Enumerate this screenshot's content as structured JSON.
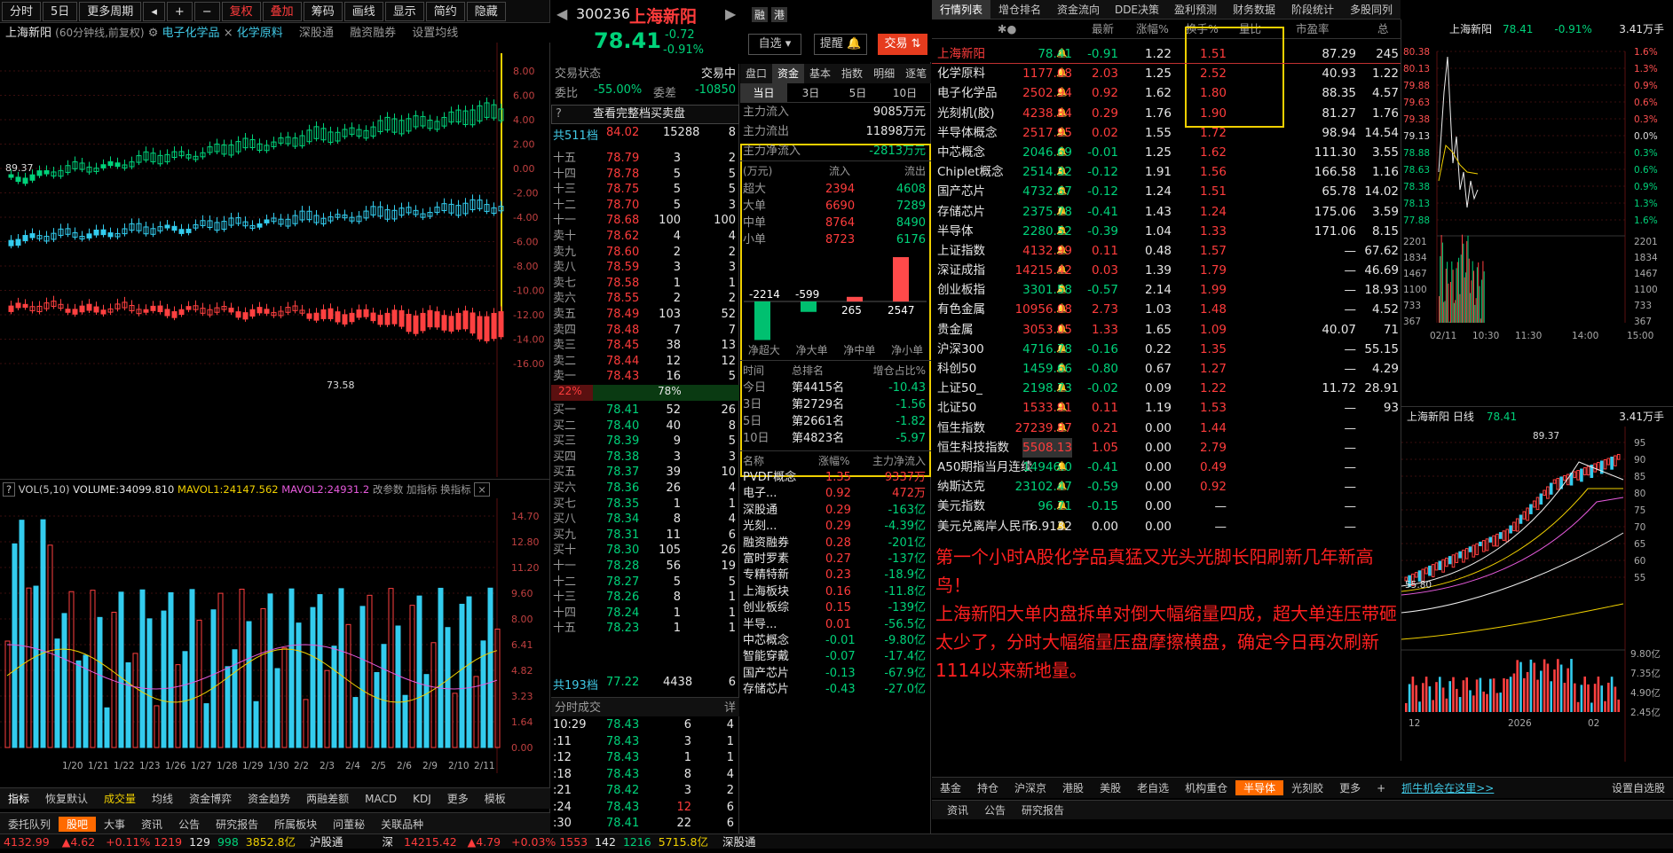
{
  "toolbar": {
    "items": [
      "分时",
      "5日",
      "更多周期",
      "复权",
      "叠加",
      "筹码",
      "画线",
      "显示",
      "简约",
      "隐藏"
    ]
  },
  "left": {
    "stock_title": "上海新阳",
    "title_meta": "(60分钟线,前复权)",
    "tags": [
      "电子化学品",
      "化学原料",
      "深股通",
      "融资融券",
      "设置均线"
    ],
    "price_axis": [
      "8.00",
      "6.00",
      "4.00",
      "2.00",
      "0.00",
      "-2.00",
      "-4.00",
      "-6.00",
      "-8.00",
      "-10.00",
      "-12.00",
      "-14.00",
      "-16.00"
    ],
    "marker_left": "89.37",
    "marker_low": "73.58",
    "vol_header": {
      "label": "VOL(5,10)",
      "volume": "VOLUME:34099.810",
      "mavol1": "MAVOL1:24147.562",
      "mavol2": "MAVOL2:24931.2",
      "params": "改参数",
      "add": "加指标",
      "swap": "换指标"
    },
    "vol_axis": [
      "14.70",
      "12.80",
      "11.20",
      "9.60",
      "8.00",
      "6.41",
      "4.82",
      "3.23",
      "1.64",
      "0.00"
    ],
    "dates": [
      "1/20",
      "1/21",
      "1/22",
      "1/23",
      "1/26",
      "1/27",
      "1/28",
      "1/29",
      "1/30",
      "2/2",
      "2/3",
      "2/4",
      "2/5",
      "2/6",
      "2/9",
      "2/10",
      "2/11"
    ],
    "ind_tabs": [
      "指标",
      "恢复默认",
      "成交量",
      "均线",
      "资金博弈",
      "资金趋势",
      "两融差额",
      "MACD",
      "KDJ",
      "更多",
      "模板"
    ],
    "bottom_tabs": [
      "委托队列",
      "股吧",
      "大事",
      "资讯",
      "公告",
      "研究报告",
      "所属板块",
      "问董秘",
      "关联品种"
    ]
  },
  "mid": {
    "code": "300236",
    "name": "上海新阳",
    "badges": [
      "融",
      "港"
    ],
    "price": "78.41",
    "chg": "-0.72",
    "pct": "-0.91%",
    "btn_watch": "自选",
    "btn_alert": "提醒",
    "btn_trade": "交易",
    "status_label": "交易状态",
    "status_value": "交易中",
    "wb_label": "委比",
    "wb_value": "-55.00%",
    "wc_label": "委差",
    "wc_value": "-10850",
    "full_btn": "查看完整档买卖盘",
    "total_sell": {
      "label": "共511档",
      "price": "84.02",
      "vol": "15288",
      "n": "8"
    },
    "asks": [
      {
        "l": "十五",
        "p": "78.79",
        "v": "3",
        "n": "2"
      },
      {
        "l": "十四",
        "p": "78.78",
        "v": "5",
        "n": "5"
      },
      {
        "l": "十三",
        "p": "78.75",
        "v": "5",
        "n": "5"
      },
      {
        "l": "十二",
        "p": "78.70",
        "v": "5",
        "n": "3"
      },
      {
        "l": "十一",
        "p": "78.68",
        "v": "100",
        "n": "100"
      },
      {
        "l": "卖十",
        "p": "78.62",
        "v": "4",
        "n": "4"
      },
      {
        "l": "卖九",
        "p": "78.60",
        "v": "2",
        "n": "2"
      },
      {
        "l": "卖八",
        "p": "78.59",
        "v": "3",
        "n": "3"
      },
      {
        "l": "卖七",
        "p": "78.58",
        "v": "1",
        "n": "1"
      },
      {
        "l": "卖六",
        "p": "78.55",
        "v": "2",
        "n": "2"
      },
      {
        "l": "卖五",
        "p": "78.49",
        "v": "103",
        "n": "52"
      },
      {
        "l": "卖四",
        "p": "78.48",
        "v": "7",
        "n": "7"
      },
      {
        "l": "卖三",
        "p": "78.45",
        "v": "38",
        "n": "13"
      },
      {
        "l": "卖二",
        "p": "78.44",
        "v": "12",
        "n": "12"
      },
      {
        "l": "卖一",
        "p": "78.43",
        "v": "16",
        "n": "5"
      }
    ],
    "ratio_left": "22%",
    "ratio_right": "78%",
    "bids": [
      {
        "l": "买一",
        "p": "78.41",
        "v": "52",
        "n": "26"
      },
      {
        "l": "买二",
        "p": "78.40",
        "v": "40",
        "n": "8"
      },
      {
        "l": "买三",
        "p": "78.39",
        "v": "9",
        "n": "5"
      },
      {
        "l": "买四",
        "p": "78.38",
        "v": "3",
        "n": "3"
      },
      {
        "l": "买五",
        "p": "78.37",
        "v": "39",
        "n": "10"
      },
      {
        "l": "买六",
        "p": "78.36",
        "v": "26",
        "n": "4"
      },
      {
        "l": "买七",
        "p": "78.35",
        "v": "1",
        "n": "1"
      },
      {
        "l": "买八",
        "p": "78.34",
        "v": "8",
        "n": "4"
      },
      {
        "l": "买九",
        "p": "78.31",
        "v": "11",
        "n": "6"
      },
      {
        "l": "买十",
        "p": "78.30",
        "v": "105",
        "n": "26"
      },
      {
        "l": "十一",
        "p": "78.28",
        "v": "56",
        "n": "19"
      },
      {
        "l": "十二",
        "p": "78.27",
        "v": "5",
        "n": "5"
      },
      {
        "l": "十三",
        "p": "78.26",
        "v": "8",
        "n": "1"
      },
      {
        "l": "十四",
        "p": "78.24",
        "v": "1",
        "n": "1"
      },
      {
        "l": "十五",
        "p": "78.23",
        "v": "1",
        "n": "1"
      }
    ],
    "total_buy": {
      "label": "共193档",
      "price": "77.22",
      "vol": "4438",
      "n": "6"
    },
    "ticks_title": "分时成交",
    "ticks_more": "详",
    "ticks": [
      {
        "t": "10:29",
        "p": "78.43",
        "v": "6",
        "n": "4"
      },
      {
        "t": ":11",
        "p": "78.43",
        "v": "3",
        "n": "1"
      },
      {
        "t": ":12",
        "p": "78.43",
        "v": "1",
        "n": "1"
      },
      {
        "t": ":18",
        "p": "78.43",
        "v": "8",
        "n": "4"
      },
      {
        "t": ":21",
        "p": "78.42",
        "v": "3",
        "n": "2"
      },
      {
        "t": ":24",
        "p": "78.43",
        "v": "12",
        "n": "6"
      },
      {
        "t": ":30",
        "p": "78.41",
        "v": "22",
        "n": "6"
      },
      {
        "t": ":39",
        "p": "78.41",
        "v": "37",
        "n": "7"
      }
    ],
    "fund_tabs": [
      "盘口",
      "资金",
      "基本",
      "指数",
      "明细",
      "逐笔"
    ],
    "period_tabs": [
      "当日",
      "3日",
      "5日",
      "10日"
    ],
    "inflow_label": "主力流入",
    "inflow": "9085万元",
    "outflow_label": "主力流出",
    "outflow": "11898万元",
    "net_label": "主力净流入",
    "net": "-2813万元",
    "flow_head": [
      "(万元)",
      "流入",
      "流出"
    ],
    "flows": [
      {
        "k": "超大",
        "in": "2394",
        "out": "4608"
      },
      {
        "k": "大单",
        "in": "6690",
        "out": "7289"
      },
      {
        "k": "中单",
        "in": "8764",
        "out": "8490"
      },
      {
        "k": "小单",
        "in": "8723",
        "out": "6176"
      }
    ],
    "net_bars": [
      {
        "label": "净超大",
        "v": -2214
      },
      {
        "label": "净大单",
        "v": -599
      },
      {
        "label": "净中单",
        "v": 265
      },
      {
        "label": "净小单",
        "v": 2547
      }
    ],
    "rank_head": [
      "时间",
      "总排名",
      "增仓占比%"
    ],
    "ranks": [
      {
        "t": "今日",
        "r": "第4415名",
        "p": "-10.43"
      },
      {
        "t": "3日",
        "r": "第2729名",
        "p": "-1.56"
      },
      {
        "t": "5日",
        "r": "第2661名",
        "p": "-1.82"
      },
      {
        "t": "10日",
        "r": "第4823名",
        "p": "-5.97"
      }
    ],
    "sector_head": [
      "名称",
      "涨幅%",
      "主力净流入"
    ],
    "sectors": [
      {
        "n": "PVDF概念",
        "c": "1.35",
        "f": "9337万"
      },
      {
        "n": "电子...",
        "c": "0.92",
        "f": "472万"
      },
      {
        "n": "深股通",
        "c": "0.29",
        "f": "-163亿"
      },
      {
        "n": "光刻...",
        "c": "0.29",
        "f": "-4.39亿"
      },
      {
        "n": "融资融券",
        "c": "0.28",
        "f": "-201亿"
      },
      {
        "n": "富时罗素",
        "c": "0.27",
        "f": "-137亿"
      },
      {
        "n": "专精特新",
        "c": "0.23",
        "f": "-18.9亿"
      },
      {
        "n": "上海板块",
        "c": "0.16",
        "f": "-11.8亿"
      },
      {
        "n": "创业板综",
        "c": "0.15",
        "f": "-139亿"
      },
      {
        "n": "半导...",
        "c": "0.01",
        "f": "-56.5亿"
      },
      {
        "n": "中芯概念",
        "c": "-0.01",
        "f": "-9.80亿"
      },
      {
        "n": "智能穿戴",
        "c": "-0.07",
        "f": "-17.4亿"
      },
      {
        "n": "国产芯片",
        "c": "-0.13",
        "f": "-67.9亿"
      },
      {
        "n": "存储芯片",
        "c": "-0.43",
        "f": "-27.0亿"
      }
    ]
  },
  "right": {
    "top_tabs": [
      "行情列表",
      "增仓排名",
      "资金流向",
      "DDE决策",
      "盈利预测",
      "财务数据",
      "阶段统计",
      "多股同列"
    ],
    "col_head": [
      "",
      "",
      "最新",
      "涨幅%",
      "换手%",
      "量比",
      "市盈率",
      "总"
    ],
    "quotes": [
      {
        "n": "上海新阳",
        "p": "78.41",
        "c": "-0.91",
        "t": "1.22",
        "r": "1.51",
        "pe": "87.29",
        "x": "245"
      },
      {
        "n": "化学原料",
        "p": "1177.08",
        "c": "2.03",
        "t": "1.25",
        "r": "2.52",
        "pe": "40.93",
        "x": "1.22"
      },
      {
        "n": "电子化学品",
        "p": "2502.94",
        "c": "0.92",
        "t": "1.62",
        "r": "1.80",
        "pe": "88.35",
        "x": "4.57"
      },
      {
        "n": "光刻机(胶)",
        "p": "4238.84",
        "c": "0.29",
        "t": "1.76",
        "r": "1.90",
        "pe": "81.27",
        "x": "1.76"
      },
      {
        "n": "半导体概念",
        "p": "2517.95",
        "c": "0.02",
        "t": "1.55",
        "r": "1.72",
        "pe": "98.94",
        "x": "14.54"
      },
      {
        "n": "中芯概念",
        "p": "2046.69",
        "c": "-0.01",
        "t": "1.25",
        "r": "1.62",
        "pe": "111.30",
        "x": "3.55"
      },
      {
        "n": "Chiplet概念",
        "p": "2514.32",
        "c": "-0.12",
        "t": "1.91",
        "r": "1.56",
        "pe": "166.58",
        "x": "1.16"
      },
      {
        "n": "国产芯片",
        "p": "4732.67",
        "c": "-0.12",
        "t": "1.24",
        "r": "1.51",
        "pe": "65.78",
        "x": "14.02"
      },
      {
        "n": "存储芯片",
        "p": "2375.78",
        "c": "-0.41",
        "t": "1.43",
        "r": "1.24",
        "pe": "175.06",
        "x": "3.59"
      },
      {
        "n": "半导体",
        "p": "2280.52",
        "c": "-0.39",
        "t": "1.04",
        "r": "1.33",
        "pe": "171.06",
        "x": "8.15"
      },
      {
        "n": "上证指数",
        "p": "4132.99",
        "c": "0.11",
        "t": "0.48",
        "r": "1.57",
        "pe": "—",
        "x": "67.62"
      },
      {
        "n": "深证成指",
        "p": "14215.42",
        "c": "0.03",
        "t": "1.39",
        "r": "1.79",
        "pe": "—",
        "x": "46.69"
      },
      {
        "n": "创业板指",
        "p": "3301.58",
        "c": "-0.57",
        "t": "2.14",
        "r": "1.99",
        "pe": "—",
        "x": "18.93"
      },
      {
        "n": "有色金属",
        "p": "10956.08",
        "c": "2.73",
        "t": "1.03",
        "r": "1.48",
        "pe": "—",
        "x": "4.52"
      },
      {
        "n": "贵金属",
        "p": "3053.05",
        "c": "1.33",
        "t": "1.65",
        "r": "1.09",
        "pe": "40.07",
        "x": "71"
      },
      {
        "n": "沪深300",
        "p": "4716.78",
        "c": "-0.16",
        "t": "0.22",
        "r": "1.35",
        "pe": "—",
        "x": "55.15"
      },
      {
        "n": "科创50",
        "p": "1459.66",
        "c": "-0.80",
        "t": "0.67",
        "r": "1.27",
        "pe": "—",
        "x": "4.29"
      },
      {
        "n": "上证50_",
        "p": "2198.73",
        "c": "-0.02",
        "t": "0.09",
        "r": "1.22",
        "pe": "11.72",
        "x": "28.91"
      },
      {
        "n": "北证50",
        "p": "1533.91",
        "c": "0.11",
        "t": "1.19",
        "r": "1.53",
        "pe": "—",
        "x": "93"
      },
      {
        "n": "恒生指数",
        "p": "27239.87",
        "c": "0.21",
        "t": "0.00",
        "r": "1.44",
        "pe": "—",
        "x": ""
      },
      {
        "n": "恒生科技指数",
        "p": "5508.13",
        "c": "1.05",
        "t": "0.00",
        "r": "2.79",
        "pe": "—",
        "x": ""
      },
      {
        "n": "A50期指当月连续",
        "p": "14946.0",
        "c": "-0.41",
        "t": "0.00",
        "r": "0.49",
        "pe": "—",
        "x": ""
      },
      {
        "n": "纳斯达克",
        "p": "23102.47",
        "c": "-0.59",
        "t": "0.00",
        "r": "0.92",
        "pe": "—",
        "x": ""
      },
      {
        "n": "美元指数",
        "p": "96.71",
        "c": "-0.15",
        "t": "0.00",
        "r": "—",
        "pe": "—",
        "x": ""
      },
      {
        "n": "美元兑离岸人民币",
        "p": "6.9132",
        "c": "0.00",
        "t": "0.00",
        "r": "—",
        "pe": "—",
        "x": ""
      }
    ],
    "comment_1": "第一个小时A股化学品真猛又光头光脚长阳刷新几年新高鸟！",
    "comment_2": "上海新阳大单内盘拆单对倒大幅缩量四成，超大单连压带砸太少了，分时大幅缩量压盘摩擦横盘，确定今日再次刷新1114以来新地量。",
    "mini_title": "上海新阳",
    "mini_price": "78.41",
    "mini_pct": "-0.91%",
    "mini_vol": "3.41万手",
    "mini_left_axis": [
      "80.38",
      "80.13",
      "79.88",
      "79.63",
      "79.38",
      "79.13",
      "78.88",
      "78.63",
      "78.38",
      "78.13",
      "77.88"
    ],
    "mini_right_axis": [
      "1.6%",
      "1.3%",
      "0.9%",
      "0.6%",
      "0.3%",
      "0.0%",
      "0.3%",
      "0.6%",
      "0.9%",
      "1.3%",
      "1.6%"
    ],
    "mini_vol_axis": [
      "2201",
      "1834",
      "1467",
      "1100",
      "733",
      "367"
    ],
    "mini_vol_right": [
      "2201",
      "1834",
      "1467",
      "1100",
      "733",
      "367"
    ],
    "mini_times": [
      "02/11",
      "10:30",
      "11:30",
      "14:00",
      "15:00"
    ],
    "day_title": "上海新阳 日线",
    "day_price": "78.41",
    "day_vol": "3.41万手",
    "day_axis": [
      "95",
      "90",
      "85",
      "80",
      "75",
      "70",
      "65",
      "60",
      "55"
    ],
    "day_high": "89.37",
    "day_low": "55.80",
    "day_vol_axis": [
      "9.80亿",
      "7.35亿",
      "4.90亿",
      "2.45亿"
    ],
    "day_dates": [
      "12",
      "2026",
      "02"
    ],
    "sector_tabs": [
      "基金",
      "持仓",
      "沪深京",
      "港股",
      "美股",
      "老自选",
      "机构重仓",
      "半导体",
      "光刻胶",
      "更多",
      "+"
    ],
    "ad": "抓牛机会在这里>>",
    "settings": "设置自选股",
    "news_tabs": [
      "资讯",
      "公告",
      "研究报告"
    ]
  },
  "status": {
    "sh": "4132.99",
    "sh_chg": "4.62",
    "sh_pct": "+0.11%",
    "sh_a": "1219",
    "sh_b": "129",
    "sh_c": "998",
    "sh_amt": "3852.8亿",
    "hgt": "沪股通",
    "sz_label": "深",
    "sz": "14215.42",
    "sz_chg": "4.79",
    "sz_pct": "+0.03%",
    "sz_a": "1553",
    "sz_b": "142",
    "sz_c": "1216",
    "sz_amt": "5715.8亿",
    "sgt": "深股通"
  }
}
